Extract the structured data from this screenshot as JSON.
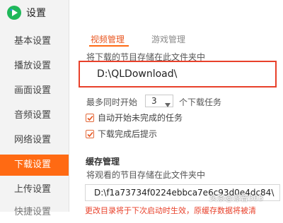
{
  "app": {
    "title": "设置",
    "logo_icon": "video-play-logo-icon"
  },
  "colors": {
    "accent": "#ff6a13",
    "highlight_border": "#e8402a"
  },
  "sidebar": {
    "items": [
      {
        "label": "基本设置"
      },
      {
        "label": "播放设置"
      },
      {
        "label": "画面设置"
      },
      {
        "label": "音频设置"
      },
      {
        "label": "网络设置"
      },
      {
        "label": "下载设置"
      },
      {
        "label": "上传设置"
      },
      {
        "label": "快捷设置"
      }
    ],
    "active_index": 5
  },
  "tabs": [
    {
      "label": "视频管理"
    },
    {
      "label": "游戏管理"
    }
  ],
  "download": {
    "store_label": "将下载的节目存储在此文件夹中",
    "path_value": "D:\\QLDownload\\",
    "max_simultaneous_label": "最多同时开始",
    "max_simultaneous_value": "3",
    "max_simultaneous_suffix": "个下载任务",
    "auto_start_label": "自动开始未完成的任务",
    "done_prompt_label": "下载完成后提示"
  },
  "cache": {
    "title": "缓存管理",
    "store_label": "将观看的节目存储在此文件夹中",
    "path_value": "D:\\f1a73734f0224ebbca7e6c93d0e4dc84\\",
    "warning": "更改目录将于下次启动时生效，原缓存数据将被清"
  },
  "watermark": "头条@涼普503"
}
